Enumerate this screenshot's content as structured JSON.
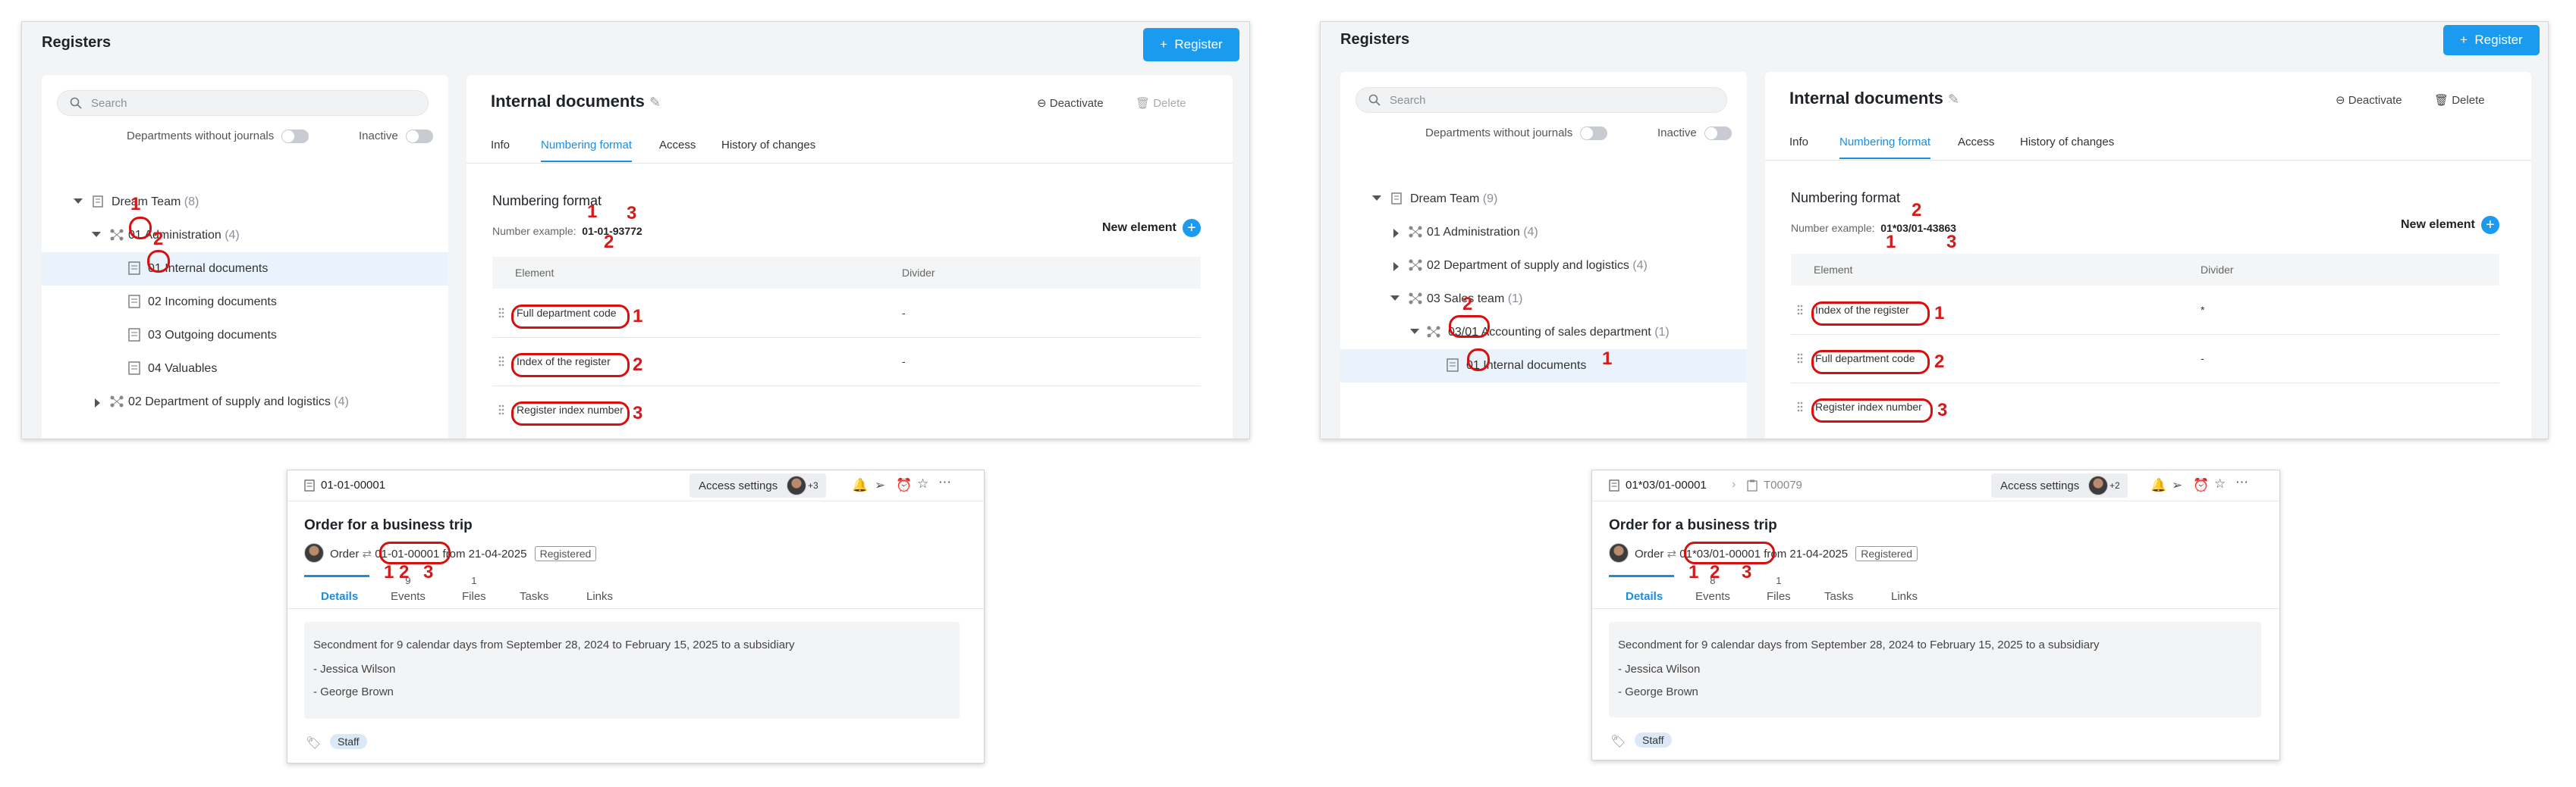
{
  "left_panel": {
    "title": "Registers",
    "register_button": "Register",
    "search_placeholder": "Search",
    "toggle_departments": "Departments without journals",
    "toggle_inactive": "Inactive",
    "tree": [
      {
        "label": "Dream Team",
        "count": "(8)"
      },
      {
        "prefix": "01",
        "label": "Administration",
        "count": "(4)"
      },
      {
        "prefix": "01",
        "label": "Internal documents"
      },
      {
        "label": "02 Incoming documents"
      },
      {
        "label": "03 Outgoing documents"
      },
      {
        "label": "04 Valuables"
      },
      {
        "label": "02 Department of supply and logistics",
        "count": "(4)"
      }
    ],
    "doc_title": "Internal documents",
    "deactivate": "Deactivate",
    "delete": "Delete",
    "tabs": [
      "Info",
      "Numbering format",
      "Access",
      "History of changes"
    ],
    "section_title": "Numbering format",
    "example_label": "Number example:",
    "example_value": "01-01-93772",
    "new_element": "New element",
    "col_element": "Element",
    "col_divider": "Divider",
    "rows": [
      {
        "element": "Full department code",
        "divider": "-"
      },
      {
        "element": "Index of the register",
        "divider": "-"
      },
      {
        "element": "Register index number",
        "divider": ""
      }
    ]
  },
  "right_panel": {
    "title": "Registers",
    "register_button": "Register",
    "search_placeholder": "Search",
    "toggle_departments": "Departments without journals",
    "toggle_inactive": "Inactive",
    "tree": [
      {
        "label": "Dream Team",
        "count": "(9)"
      },
      {
        "label": "01 Administration",
        "count": "(4)"
      },
      {
        "label": "02 Department of supply and logistics",
        "count": "(4)"
      },
      {
        "label": "03 Sales team",
        "count": "(1)"
      },
      {
        "prefix": "03/01",
        "label": "Accounting of sales department",
        "count": "(1)"
      },
      {
        "prefix": "01",
        "label": "Internal documents"
      }
    ],
    "doc_title": "Internal documents",
    "deactivate": "Deactivate",
    "delete": "Delete",
    "tabs": [
      "Info",
      "Numbering format",
      "Access",
      "History of changes"
    ],
    "section_title": "Numbering format",
    "example_label": "Number example:",
    "example_value": "01*03/01-43863",
    "new_element": "New element",
    "col_element": "Element",
    "col_divider": "Divider",
    "rows": [
      {
        "element": "Index of the register",
        "divider": "*"
      },
      {
        "element": "Full department code",
        "divider": "-"
      },
      {
        "element": "Register index number",
        "divider": ""
      }
    ]
  },
  "left_card": {
    "doc_number": "01-01-00001",
    "access_settings": "Access settings",
    "avatar_extra": "+3",
    "title": "Order for a business trip",
    "type": "Order",
    "number": "01-01-00001",
    "date_text": "from 21-04-2025",
    "status": "Registered",
    "tabs": [
      {
        "label": "Details",
        "count": ""
      },
      {
        "label": "Events",
        "count": "9"
      },
      {
        "label": "Files",
        "count": "1"
      },
      {
        "label": "Tasks",
        "count": ""
      },
      {
        "label": "Links",
        "count": ""
      }
    ],
    "content": [
      "Secondment for 9 calendar days from September 28, 2024 to February 15, 2025 to a subsidiary",
      "- Jessica Wilson",
      "- George Brown"
    ],
    "tag": "Staff"
  },
  "right_card": {
    "doc_number": "01*03/01-00001",
    "linked_doc": "T00079",
    "access_settings": "Access settings",
    "avatar_extra": "+2",
    "title": "Order for a business trip",
    "type": "Order",
    "number": "01*03/01-00001",
    "date_text": "from 21-04-2025",
    "status": "Registered",
    "tabs": [
      {
        "label": "Details",
        "count": ""
      },
      {
        "label": "Events",
        "count": "8"
      },
      {
        "label": "Files",
        "count": "1"
      },
      {
        "label": "Tasks",
        "count": ""
      },
      {
        "label": "Links",
        "count": ""
      }
    ],
    "content": [
      "Secondment for 9 calendar days from September 28, 2024 to February 15, 2025 to a subsidiary",
      "- Jessica Wilson",
      "- George Brown"
    ],
    "tag": "Staff"
  },
  "annotations": {
    "one": "1",
    "two": "2",
    "three": "3"
  },
  "colors": {
    "accent": "#1a9bf0",
    "annotation": "#d60f0f"
  }
}
